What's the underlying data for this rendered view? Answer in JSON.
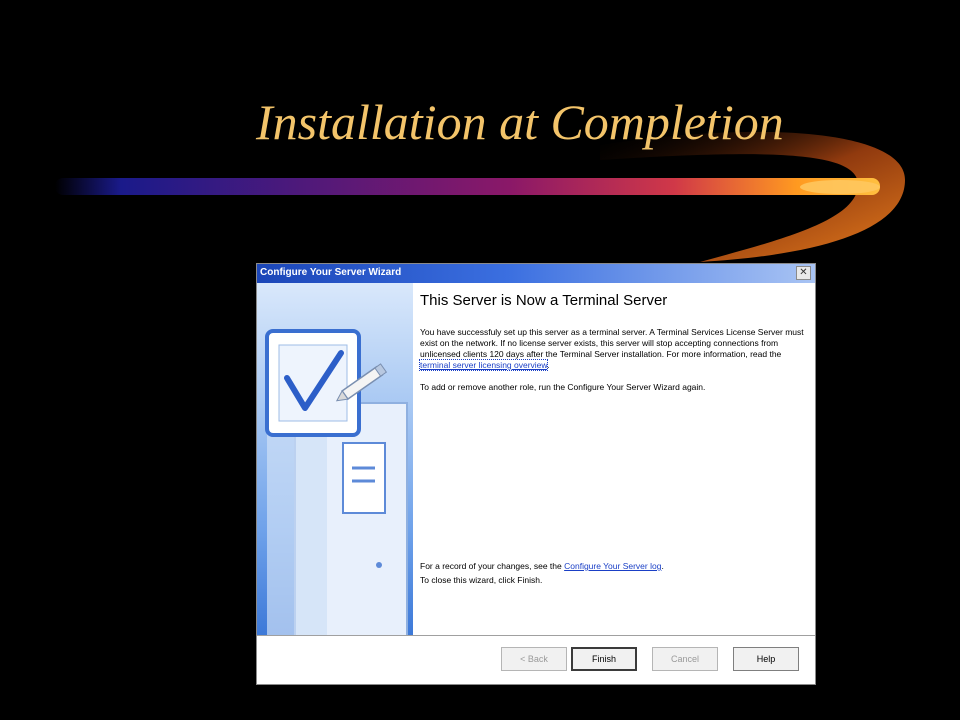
{
  "slide": {
    "title": "Installation at Completion"
  },
  "colors": {
    "title": "#f3c46a",
    "swoosh_start": "#1a1a8a",
    "swoosh_mid": "#c01860",
    "swoosh_end": "#ffb030",
    "titlebar_start": "#1b46b8",
    "link": "#1a3fc6"
  },
  "wizard": {
    "title": "Configure Your Server Wizard",
    "close_glyph": "✕",
    "heading": "This Server is Now a Terminal Server",
    "para1_text": "You have successfuly set up this server as a terminal server. A Terminal Services License Server must exist on the network. If no license server exists, this server will stop accepting connections from unlicensed clients 120 days after the Terminal Server installation. For more information, read the ",
    "para1_link": "terminal server licensing overview",
    "para1_end": ".",
    "para2_text": "To add or remove another role, run the Configure Your Server Wizard again.",
    "footer_line1_text": "For a record of your changes, see the ",
    "footer_line1_link": "Configure Your Server log",
    "footer_line1_end": ".",
    "footer_line2_text": "To close this wizard, click Finish.",
    "buttons": {
      "back": "< Back",
      "finish": "Finish",
      "cancel": "Cancel",
      "help": "Help"
    },
    "side_icons": [
      "checkbox-document-icon",
      "pencil-icon",
      "server-tower-icon"
    ]
  }
}
